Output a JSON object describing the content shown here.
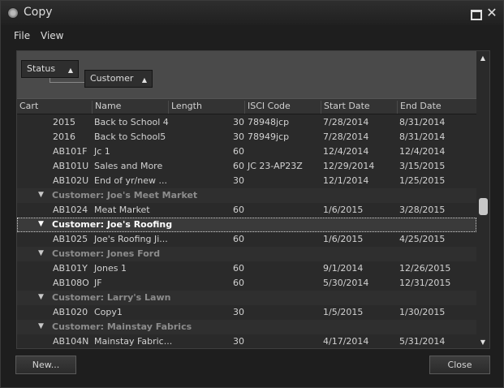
{
  "window": {
    "title": "Copy",
    "app_icon": "gear-icon",
    "controls": {
      "restore_icon": "restore-icon",
      "close_icon": "close-icon",
      "close_glyph": "✕"
    }
  },
  "menu": {
    "file": "File",
    "view": "View"
  },
  "grouping": {
    "chips": [
      {
        "label": "Status",
        "sort": "▲"
      },
      {
        "label": "Customer",
        "sort": "▲"
      }
    ]
  },
  "columns": {
    "cart": "Cart",
    "name": "Name",
    "length": "Length",
    "isci": "ISCI Code",
    "start": "Start Date",
    "end": "End Date"
  },
  "rows": [
    {
      "cart": "2015",
      "name": "Back to School 4",
      "length": "30",
      "isci": "78948jcp",
      "start": "7/28/2014",
      "end": "8/31/2014"
    },
    {
      "cart": "2016",
      "name": "Back to School5",
      "length": "30",
      "isci": "78949jcp",
      "start": "7/28/2014",
      "end": "8/31/2014"
    },
    {
      "cart": "AB101F",
      "name": "Jc 1",
      "length": "60",
      "isci": "",
      "start": "12/4/2014",
      "end": "12/4/2014"
    },
    {
      "cart": "AB101U",
      "name": "Sales and More",
      "length": "60",
      "isci": "JC 23-AP23Z",
      "start": "12/29/2014",
      "end": "3/15/2015"
    },
    {
      "cart": "AB102U",
      "name": "End of yr/new ...",
      "length": "30",
      "isci": "",
      "start": "12/1/2014",
      "end": "1/25/2015"
    }
  ],
  "groups": [
    {
      "label": "Customer: Joe's Meet Market",
      "rows": [
        {
          "cart": "AB1024",
          "name": "Meat Market",
          "length": "60",
          "isci": "",
          "start": "1/6/2015",
          "end": "3/28/2015"
        }
      ]
    },
    {
      "label": "Customer: Joe's Roofing",
      "selected": true,
      "rows": [
        {
          "cart": "AB1025",
          "name": "Joe's Roofing Ji...",
          "length": "60",
          "isci": "",
          "start": "1/6/2015",
          "end": "4/25/2015"
        }
      ]
    },
    {
      "label": "Customer: Jones Ford",
      "rows": [
        {
          "cart": "AB101Y",
          "name": "Jones 1",
          "length": "60",
          "isci": "",
          "start": "9/1/2014",
          "end": "12/26/2015"
        },
        {
          "cart": "AB108O",
          "name": "JF",
          "length": "60",
          "isci": "",
          "start": "5/30/2014",
          "end": "12/31/2015"
        }
      ]
    },
    {
      "label": "Customer: Larry's Lawn",
      "rows": [
        {
          "cart": "AB1020",
          "name": "Copy1",
          "length": "30",
          "isci": "",
          "start": "1/5/2015",
          "end": "1/30/2015"
        }
      ]
    },
    {
      "label": "Customer: Mainstay Fabrics",
      "rows": [
        {
          "cart": "AB104N",
          "name": "Mainstay Fabric...",
          "length": "30",
          "isci": "",
          "start": "4/17/2014",
          "end": "5/31/2014"
        }
      ]
    }
  ],
  "scrollbar": {
    "up": "▲",
    "down": "▼"
  },
  "buttons": {
    "new": "New...",
    "close": "Close"
  },
  "colors": {
    "background": "#1e1e1e",
    "group_area": "#4a4a4a",
    "group_text": "#8c8c8c",
    "selected_text": "#ffffff"
  }
}
